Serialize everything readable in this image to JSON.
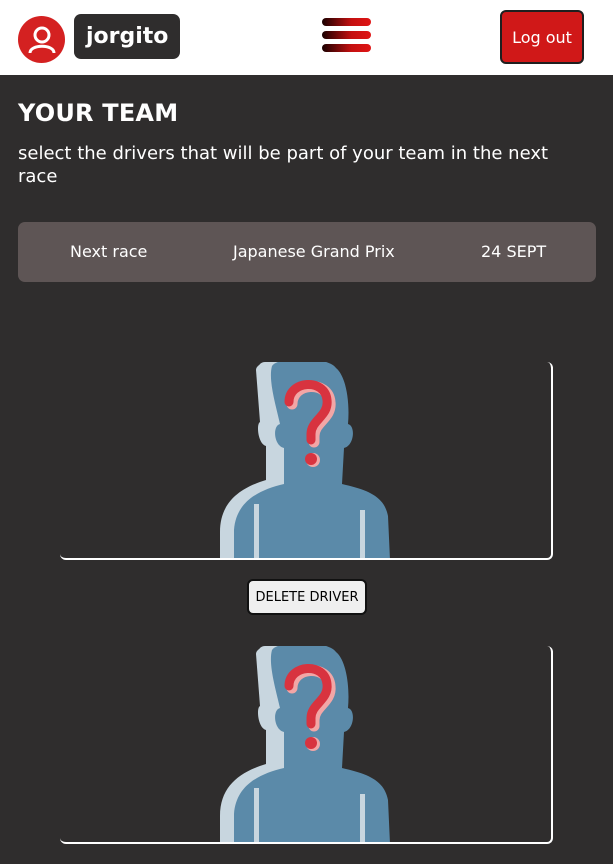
{
  "header": {
    "username": "jorgito",
    "logout_label": "Log out",
    "icons": {
      "avatar": "user-icon",
      "menu": "hamburger-menu-icon"
    },
    "colors": {
      "accent": "#d01818",
      "background": "#2f2d2d",
      "banner": "#5e5555"
    }
  },
  "main": {
    "title": "YOUR TEAM",
    "subtitle": "select the drivers that will be part of your team in the next race"
  },
  "race": {
    "label": "Next race",
    "name": "Japanese Grand Prix",
    "date": "24 SEPT"
  },
  "drivers": {
    "slots": [
      {
        "placeholder_icon": "unknown-driver-icon"
      },
      {
        "placeholder_icon": "unknown-driver-icon"
      }
    ],
    "delete_label": "DELETE DRIVER"
  }
}
